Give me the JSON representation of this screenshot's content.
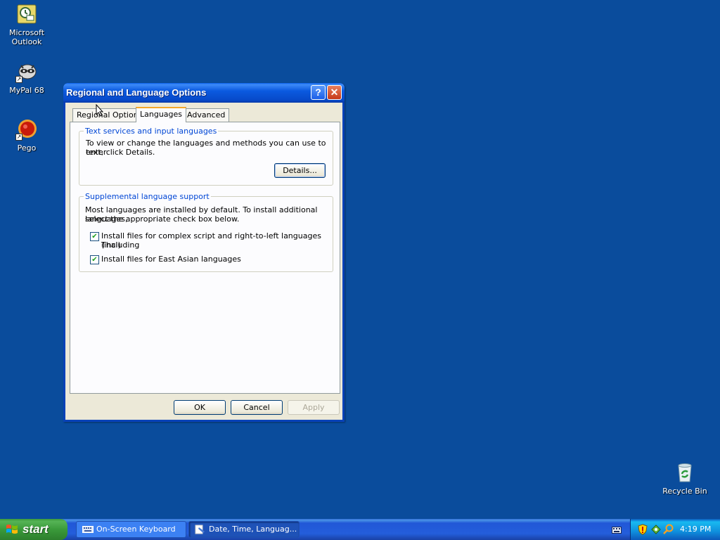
{
  "desktop": {
    "icons": [
      {
        "label": "Microsoft Outlook",
        "icon": "outlook-icon"
      },
      {
        "label": "MyPal 68",
        "icon": "mypal-icon"
      },
      {
        "label": "Pego",
        "icon": "pego-icon"
      },
      {
        "label": "Recycle Bin",
        "icon": "recycle-bin-icon"
      }
    ]
  },
  "dialog": {
    "title": "Regional and Language Options",
    "help_label": "?",
    "close_label": "✕",
    "tabs": [
      {
        "label": "Regional Options"
      },
      {
        "label": "Languages"
      },
      {
        "label": "Advanced"
      }
    ],
    "active_tab": "Languages",
    "text_services": {
      "legend": "Text services and input languages",
      "description_line1": "To view or change the languages and methods you can use to enter",
      "description_line2": "text, click Details.",
      "details_button": "Details..."
    },
    "supplemental": {
      "legend": "Supplemental language support",
      "description_line1": "Most languages are installed by default. To install additional languages,",
      "description_line2": "select the appropriate check box below.",
      "complex_script_line1": "Install files for complex script and right-to-left languages (including",
      "complex_script_line2": "Thai)",
      "complex_script_checked": true,
      "east_asian": "Install files for East Asian languages",
      "east_asian_checked": true
    },
    "buttons": {
      "ok": "OK",
      "cancel": "Cancel",
      "apply": "Apply"
    }
  },
  "taskbar": {
    "start_label": "start",
    "tasks": [
      {
        "label": "On-Screen Keyboard",
        "icon": "keyboard-icon"
      },
      {
        "label": "Date, Time, Languag...",
        "icon": "control-panel-icon"
      }
    ],
    "clock": "4:19 PM"
  },
  "colors": {
    "desktop": "#0a4c9c",
    "titlebar": "#0b5ae0",
    "dialog_bg": "#ece9d8",
    "group_legend": "#0046d5",
    "start_green": "#3a9a3a"
  }
}
